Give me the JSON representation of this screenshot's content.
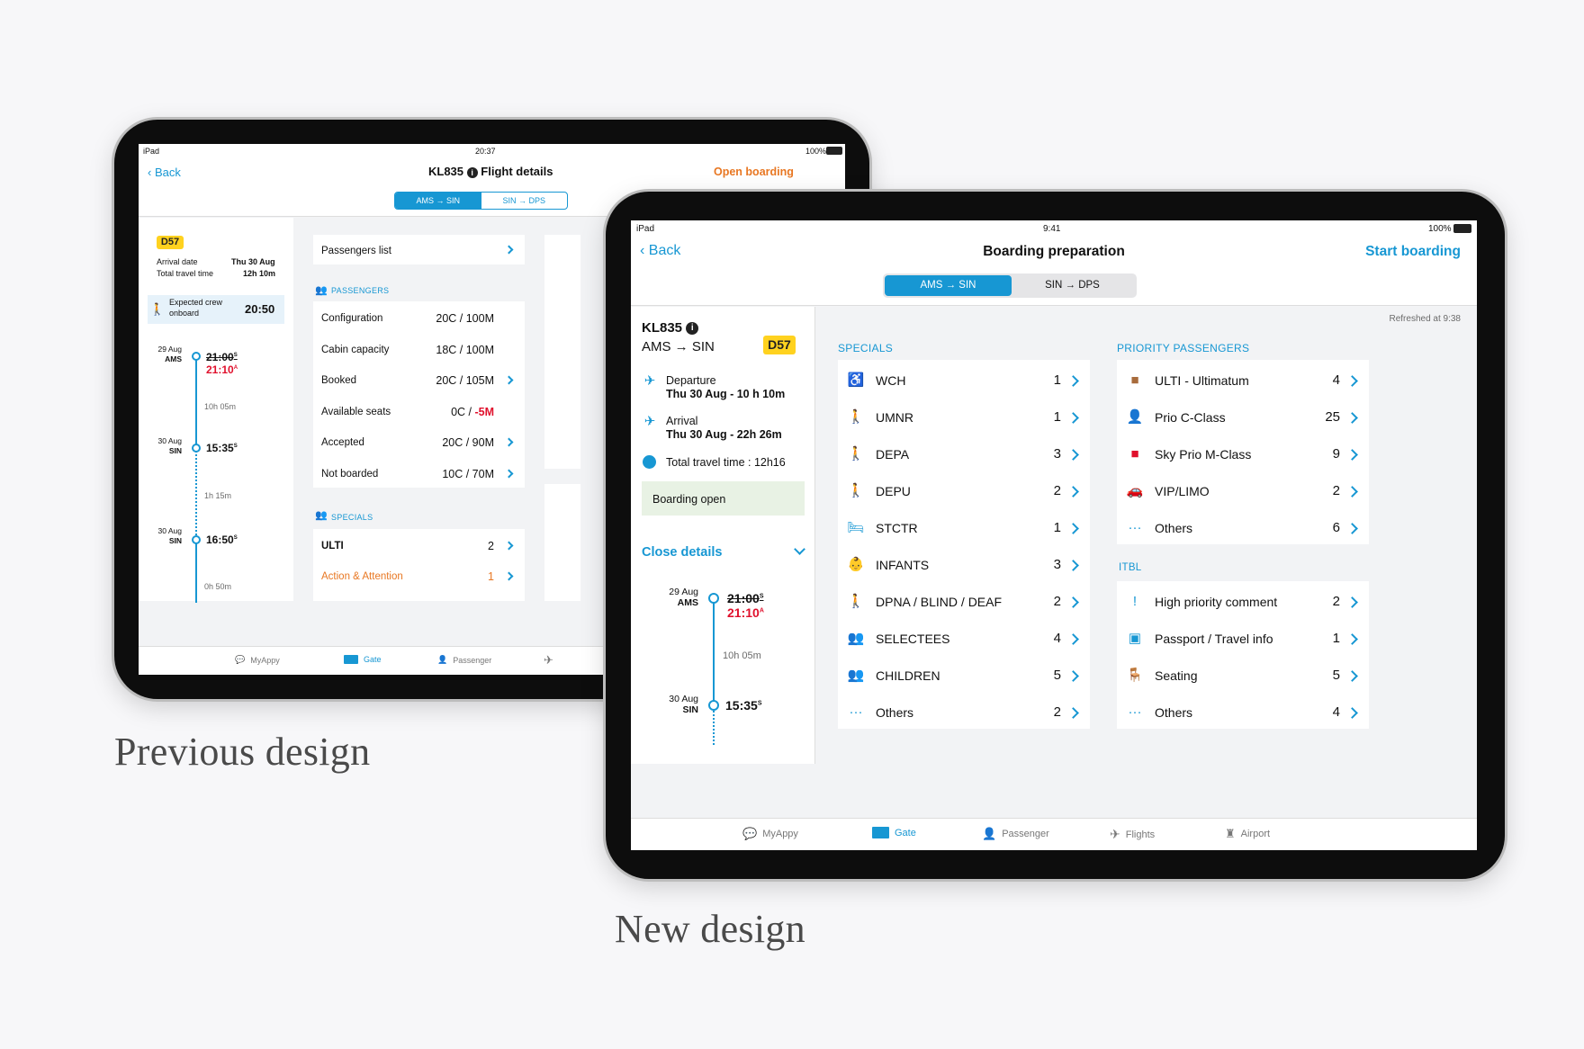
{
  "captions": {
    "previous": "Previous design",
    "new": "New design"
  },
  "old": {
    "status": {
      "device": "iPad",
      "time": "20:37",
      "battery": "100%"
    },
    "nav": {
      "back": "Back",
      "flight": "KL835",
      "title": "Flight details",
      "action": "Open boarding"
    },
    "segments": [
      "AMS → SIN",
      "SIN → DPS"
    ],
    "summary": {
      "gate": "D57",
      "arrival_label": "Arrival date",
      "arrival_value": "Thu 30 Aug",
      "travel_label": "Total travel time",
      "travel_value": "12h 10m"
    },
    "crew": {
      "label_1": "Expected crew",
      "label_2": "onboard",
      "time": "20:50"
    },
    "timeline": [
      {
        "date": "29 Aug",
        "code": "AMS",
        "time_old": "21:00",
        "time_old_sup": "S",
        "time_new": "21:10",
        "time_new_sup": "A"
      },
      {
        "duration": "10h 05m"
      },
      {
        "date": "30 Aug",
        "code": "SIN",
        "time": "15:35",
        "sup": "S"
      },
      {
        "duration": "1h 15m"
      },
      {
        "date": "30 Aug",
        "code": "SIN",
        "time": "16:50",
        "sup": "S"
      },
      {
        "duration": "0h 50m"
      }
    ],
    "passengers_list": "Passengers list",
    "passengers_header": "PASSENGERS",
    "passengers": [
      {
        "label": "Configuration",
        "value": "20C / 100M",
        "extra": "",
        "chevron": false
      },
      {
        "label": "Cabin capacity",
        "value": "18C / 100M",
        "extra": "",
        "chevron": false
      },
      {
        "label": "Booked",
        "value": "20C / 105M",
        "extra": "",
        "chevron": true
      },
      {
        "label": "Available seats",
        "value": "0C / ",
        "extra": "-5M",
        "chevron": false
      },
      {
        "label": "Accepted",
        "value": "20C / 90M",
        "extra": "",
        "chevron": true
      },
      {
        "label": "Not boarded",
        "value": "10C / 70M",
        "extra": "",
        "chevron": true
      }
    ],
    "specials_header": "SPECIALS",
    "specials": [
      {
        "label": "ULTI",
        "count": "2"
      },
      {
        "label": "Action & Attention",
        "count": "1"
      }
    ],
    "tabs": [
      "MyAppy",
      "Gate",
      "Passenger"
    ]
  },
  "new": {
    "status": {
      "device": "iPad",
      "time": "9:41",
      "battery": "100%"
    },
    "nav": {
      "back": "Back",
      "title": "Boarding preparation",
      "action": "Start boarding"
    },
    "segments": [
      "AMS → SIN",
      "SIN → DPS"
    ],
    "refreshed": "Refreshed at 9:38",
    "flight": {
      "number": "KL835",
      "route": "AMS → SIN",
      "gate": "D57"
    },
    "departure": {
      "label": "Departure",
      "value": "Thu 30 Aug  - 10 h 10m"
    },
    "arrival": {
      "label": "Arrival",
      "value": "Thu 30 Aug  - 22h 26m"
    },
    "travel": "Total travel time : 12h16",
    "boarding_status": "Boarding open",
    "close_details": "Close details",
    "timeline": [
      {
        "date": "29 Aug",
        "code": "AMS",
        "time_old": "21:00",
        "time_old_sup": "S",
        "time_new": "21:10",
        "time_new_sup": "A"
      },
      {
        "duration": "10h 05m"
      },
      {
        "date": "30 Aug",
        "code": "SIN",
        "time": "15:35",
        "sup": "S"
      }
    ],
    "specials_header": "SPECIALS",
    "specials": [
      {
        "icon": "wheelchair-icon",
        "label": "WCH",
        "count": "1"
      },
      {
        "icon": "umnr-icon",
        "label": "UMNR",
        "count": "1"
      },
      {
        "icon": "depa-icon",
        "label": "DEPA",
        "count": "3"
      },
      {
        "icon": "depu-icon",
        "label": "DEPU",
        "count": "2"
      },
      {
        "icon": "stretcher-icon",
        "label": "STCTR",
        "count": "1"
      },
      {
        "icon": "infant-icon",
        "label": "INFANTS",
        "count": "3"
      },
      {
        "icon": "dpna-icon",
        "label": "DPNA / BLIND / DEAF",
        "count": "2"
      },
      {
        "icon": "selectee-icon",
        "label": "SELECTEES",
        "count": "4"
      },
      {
        "icon": "children-icon",
        "label": "CHILDREN",
        "count": "5"
      },
      {
        "icon": "more-icon",
        "label": "Others",
        "count": "2"
      }
    ],
    "priority_header": "PRIORITY PASSENGERS",
    "priority": [
      {
        "icon": "ulti-card-icon",
        "label": "ULTI - Ultimatum",
        "count": "4"
      },
      {
        "icon": "prio-c-icon",
        "label": "Prio C-Class",
        "count": "25"
      },
      {
        "icon": "sky-prio-card-icon",
        "label": "Sky Prio M-Class",
        "count": "9"
      },
      {
        "icon": "car-icon",
        "label": "VIP/LIMO",
        "count": "2"
      },
      {
        "icon": "more-icon",
        "label": "Others",
        "count": "6"
      }
    ],
    "itbl_header": "ITBL",
    "itbl": [
      {
        "icon": "alert-comment-icon",
        "label": "High priority comment",
        "count": "2"
      },
      {
        "icon": "passport-icon",
        "label": "Passport / Travel info",
        "count": "1"
      },
      {
        "icon": "seat-icon",
        "label": "Seating",
        "count": "5"
      },
      {
        "icon": "more-icon",
        "label": "Others",
        "count": "4"
      }
    ],
    "tabs": [
      "MyAppy",
      "Gate",
      "Passenger",
      "Flights",
      "Airport"
    ]
  },
  "colors": {
    "accent": "#1797d3",
    "action_orange": "#e87722",
    "alert_red": "#e0102c",
    "gate_yellow": "#ffd21f",
    "boarding_green": "#e8f2e4"
  }
}
